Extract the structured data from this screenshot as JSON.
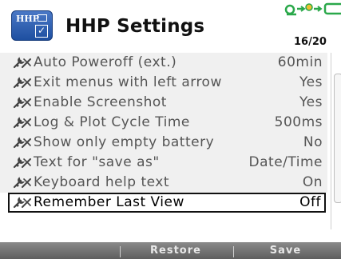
{
  "header": {
    "logo_text": "HHP",
    "title": "HHP Settings",
    "page_indicator": "16/20"
  },
  "settings": [
    {
      "label": "Auto Poweroff (ext.)",
      "value": "60min"
    },
    {
      "label": "Exit menus with left arrow",
      "value": "Yes"
    },
    {
      "label": "Enable Screenshot",
      "value": "Yes"
    },
    {
      "label": "Log & Plot Cycle Time",
      "value": "500ms"
    },
    {
      "label": "Show only empty battery",
      "value": "No"
    },
    {
      "label": "Text for \"save as\"",
      "value": "Date/Time"
    },
    {
      "label": "Keyboard help text",
      "value": "On"
    },
    {
      "label": "Remember Last View",
      "value": "Off"
    }
  ],
  "selected_index": 7,
  "softkeys": {
    "restore": "Restore",
    "save": "Save"
  },
  "colors": {
    "logo_blue": "#1e4fa0",
    "row_background": "#f0f0f0",
    "status_icon_green": "#2aa84a",
    "softkey_bar": "#6e6e6e"
  },
  "icons": {
    "logo": "hhp-logo-icon",
    "row": "wrench-settings-icon",
    "status": "connection-status-icon"
  }
}
